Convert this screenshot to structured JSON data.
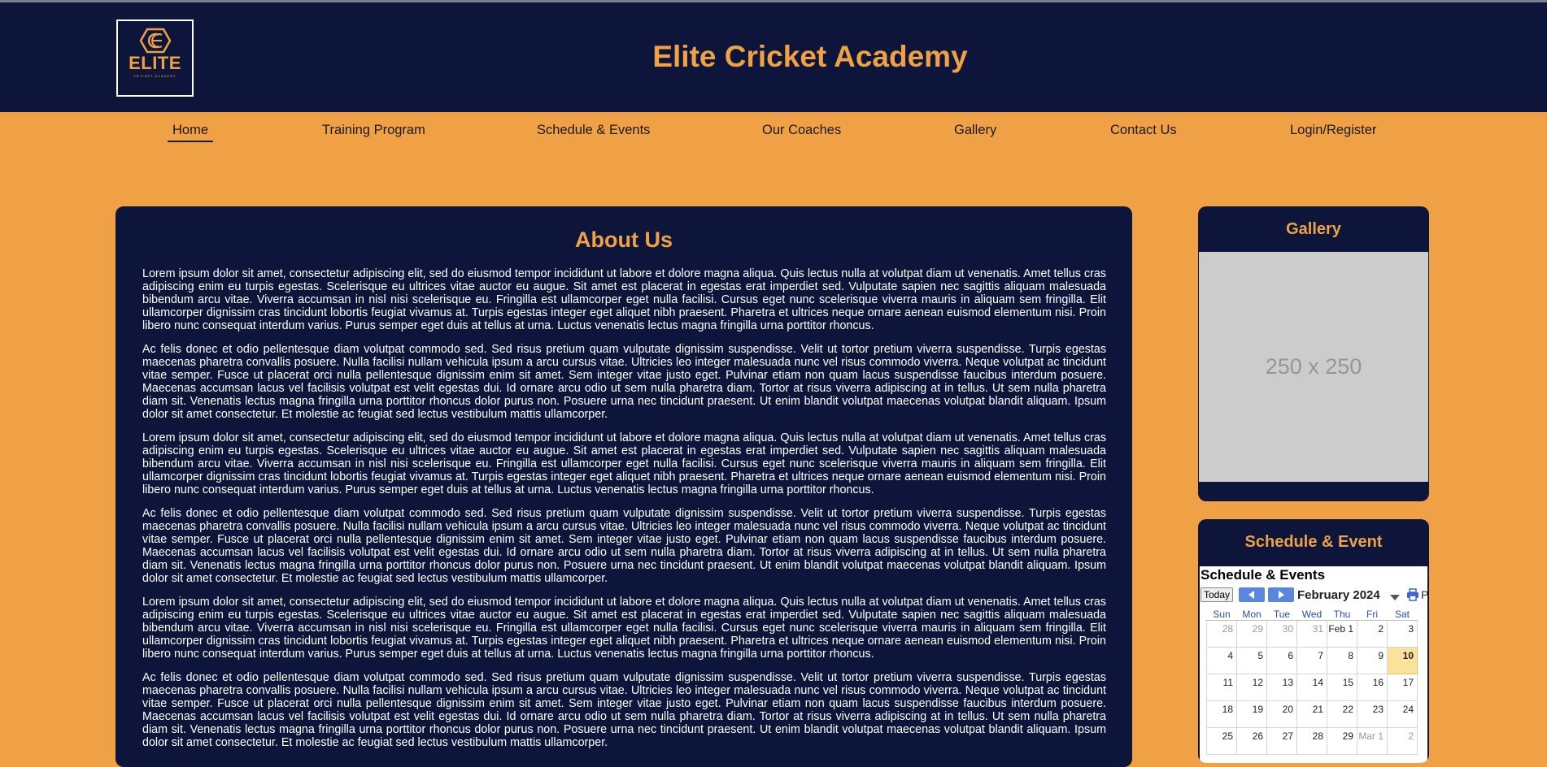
{
  "header": {
    "logo_word": "ELITE",
    "logo_sub": "CRICKET ACADEMY",
    "site_title": "Elite Cricket Academy"
  },
  "nav": [
    {
      "label": "Home",
      "active": true
    },
    {
      "label": "Training Program"
    },
    {
      "label": "Schedule & Events"
    },
    {
      "label": "Our Coaches"
    },
    {
      "label": "Gallery"
    },
    {
      "label": "Contact Us"
    },
    {
      "label": "Login/Register"
    }
  ],
  "about": {
    "title": "About Us",
    "paragraphs": [
      "Lorem ipsum dolor sit amet, consectetur adipiscing elit, sed do eiusmod tempor incididunt ut labore et dolore magna aliqua. Quis lectus nulla at volutpat diam ut venenatis. Amet tellus cras adipiscing enim eu turpis egestas. Scelerisque eu ultrices vitae auctor eu augue. Sit amet est placerat in egestas erat imperdiet sed. Vulputate sapien nec sagittis aliquam malesuada bibendum arcu vitae. Viverra accumsan in nisl nisi scelerisque eu. Fringilla est ullamcorper eget nulla facilisi. Cursus eget nunc scelerisque viverra mauris in aliquam sem fringilla. Elit ullamcorper dignissim cras tincidunt lobortis feugiat vivamus at. Turpis egestas integer eget aliquet nibh praesent. Pharetra et ultrices neque ornare aenean euismod elementum nisi. Proin libero nunc consequat interdum varius. Purus semper eget duis at tellus at urna. Luctus venenatis lectus magna fringilla urna porttitor rhoncus.",
      "Ac felis donec et odio pellentesque diam volutpat commodo sed. Sed risus pretium quam vulputate dignissim suspendisse. Velit ut tortor pretium viverra suspendisse. Turpis egestas maecenas pharetra convallis posuere. Nulla facilisi nullam vehicula ipsum a arcu cursus vitae. Ultricies leo integer malesuada nunc vel risus commodo viverra. Neque volutpat ac tincidunt vitae semper. Fusce ut placerat orci nulla pellentesque dignissim enim sit amet. Sem integer vitae justo eget. Pulvinar etiam non quam lacus suspendisse faucibus interdum posuere. Maecenas accumsan lacus vel facilisis volutpat est velit egestas dui. Id ornare arcu odio ut sem nulla pharetra diam. Tortor at risus viverra adipiscing at in tellus. Ut sem nulla pharetra diam sit. Venenatis lectus magna fringilla urna porttitor rhoncus dolor purus non. Posuere urna nec tincidunt praesent. Ut enim blandit volutpat maecenas volutpat blandit aliquam. Ipsum dolor sit amet consectetur. Et molestie ac feugiat sed lectus vestibulum mattis ullamcorper.",
      "Lorem ipsum dolor sit amet, consectetur adipiscing elit, sed do eiusmod tempor incididunt ut labore et dolore magna aliqua. Quis lectus nulla at volutpat diam ut venenatis. Amet tellus cras adipiscing enim eu turpis egestas. Scelerisque eu ultrices vitae auctor eu augue. Sit amet est placerat in egestas erat imperdiet sed. Vulputate sapien nec sagittis aliquam malesuada bibendum arcu vitae. Viverra accumsan in nisl nisi scelerisque eu. Fringilla est ullamcorper eget nulla facilisi. Cursus eget nunc scelerisque viverra mauris in aliquam sem fringilla. Elit ullamcorper dignissim cras tincidunt lobortis feugiat vivamus at. Turpis egestas integer eget aliquet nibh praesent. Pharetra et ultrices neque ornare aenean euismod elementum nisi. Proin libero nunc consequat interdum varius. Purus semper eget duis at tellus at urna. Luctus venenatis lectus magna fringilla urna porttitor rhoncus.",
      "Ac felis donec et odio pellentesque diam volutpat commodo sed. Sed risus pretium quam vulputate dignissim suspendisse. Velit ut tortor pretium viverra suspendisse. Turpis egestas maecenas pharetra convallis posuere. Nulla facilisi nullam vehicula ipsum a arcu cursus vitae. Ultricies leo integer malesuada nunc vel risus commodo viverra. Neque volutpat ac tincidunt vitae semper. Fusce ut placerat orci nulla pellentesque dignissim enim sit amet. Sem integer vitae justo eget. Pulvinar etiam non quam lacus suspendisse faucibus interdum posuere. Maecenas accumsan lacus vel facilisis volutpat est velit egestas dui. Id ornare arcu odio ut sem nulla pharetra diam. Tortor at risus viverra adipiscing at in tellus. Ut sem nulla pharetra diam sit. Venenatis lectus magna fringilla urna porttitor rhoncus dolor purus non. Posuere urna nec tincidunt praesent. Ut enim blandit volutpat maecenas volutpat blandit aliquam. Ipsum dolor sit amet consectetur. Et molestie ac feugiat sed lectus vestibulum mattis ullamcorper.",
      "Lorem ipsum dolor sit amet, consectetur adipiscing elit, sed do eiusmod tempor incididunt ut labore et dolore magna aliqua. Quis lectus nulla at volutpat diam ut venenatis. Amet tellus cras adipiscing enim eu turpis egestas. Scelerisque eu ultrices vitae auctor eu augue. Sit amet est placerat in egestas erat imperdiet sed. Vulputate sapien nec sagittis aliquam malesuada bibendum arcu vitae. Viverra accumsan in nisl nisi scelerisque eu. Fringilla est ullamcorper eget nulla facilisi. Cursus eget nunc scelerisque viverra mauris in aliquam sem fringilla. Elit ullamcorper dignissim cras tincidunt lobortis feugiat vivamus at. Turpis egestas integer eget aliquet nibh praesent. Pharetra et ultrices neque ornare aenean euismod elementum nisi. Proin libero nunc consequat interdum varius. Purus semper eget duis at tellus at urna. Luctus venenatis lectus magna fringilla urna porttitor rhoncus.",
      "Ac felis donec et odio pellentesque diam volutpat commodo sed. Sed risus pretium quam vulputate dignissim suspendisse. Velit ut tortor pretium viverra suspendisse. Turpis egestas maecenas pharetra convallis posuere. Nulla facilisi nullam vehicula ipsum a arcu cursus vitae. Ultricies leo integer malesuada nunc vel risus commodo viverra. Neque volutpat ac tincidunt vitae semper. Fusce ut placerat orci nulla pellentesque dignissim enim sit amet. Sem integer vitae justo eget. Pulvinar etiam non quam lacus suspendisse faucibus interdum posuere. Maecenas accumsan lacus vel facilisis volutpat est velit egestas dui. Id ornare arcu odio ut sem nulla pharetra diam. Tortor at risus viverra adipiscing at in tellus. Ut sem nulla pharetra diam sit. Venenatis lectus magna fringilla urna porttitor rhoncus dolor purus non. Posuere urna nec tincidunt praesent. Ut enim blandit volutpat maecenas volutpat blandit aliquam. Ipsum dolor sit amet consectetur. Et molestie ac feugiat sed lectus vestibulum mattis ullamcorper."
    ]
  },
  "gallery": {
    "title": "Gallery",
    "placeholder_text": "250 x 250"
  },
  "schedule": {
    "title": "Schedule & Event",
    "calendar": {
      "heading": "Schedule & Events",
      "today_label": "Today",
      "month_label": "February 2024",
      "print_label": "P",
      "weekdays": [
        "Sun",
        "Mon",
        "Tue",
        "Wed",
        "Thu",
        "Fri",
        "Sat"
      ],
      "weeks": [
        [
          {
            "d": "28",
            "other": true
          },
          {
            "d": "29",
            "other": true
          },
          {
            "d": "30",
            "other": true
          },
          {
            "d": "31",
            "other": true
          },
          {
            "d": "Feb 1"
          },
          {
            "d": "2"
          },
          {
            "d": "3"
          }
        ],
        [
          {
            "d": "4"
          },
          {
            "d": "5"
          },
          {
            "d": "6"
          },
          {
            "d": "7"
          },
          {
            "d": "8"
          },
          {
            "d": "9"
          },
          {
            "d": "10",
            "today": true
          }
        ],
        [
          {
            "d": "11"
          },
          {
            "d": "12"
          },
          {
            "d": "13"
          },
          {
            "d": "14"
          },
          {
            "d": "15"
          },
          {
            "d": "16"
          },
          {
            "d": "17"
          }
        ],
        [
          {
            "d": "18"
          },
          {
            "d": "19"
          },
          {
            "d": "20"
          },
          {
            "d": "21"
          },
          {
            "d": "22"
          },
          {
            "d": "23"
          },
          {
            "d": "24"
          }
        ],
        [
          {
            "d": "25"
          },
          {
            "d": "26"
          },
          {
            "d": "27"
          },
          {
            "d": "28"
          },
          {
            "d": "29"
          },
          {
            "d": "Mar 1",
            "other": true
          },
          {
            "d": "2",
            "other": true
          }
        ]
      ]
    }
  },
  "colors": {
    "navy": "#0d163a",
    "orange": "#f0a145",
    "today_highlight": "#fae29a"
  }
}
